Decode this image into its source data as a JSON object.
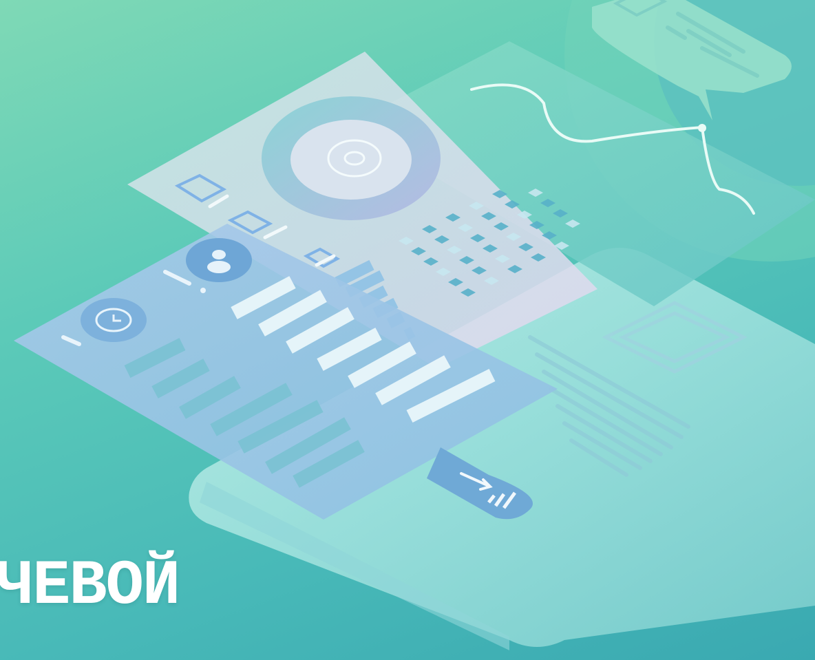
{
  "caption": {
    "text": "ЧЕВОЙ"
  },
  "colors": {
    "bg_top": "#7fd9b6",
    "bg_bottom": "#3aa9b1",
    "phone_body": "#a6e6e3",
    "panel_front": "#9cc8e6",
    "panel_middle": "#d7e0ee",
    "panel_back": "#7fd6c4",
    "accent_bar": "#e8f6f8",
    "dark_accent": "#6aa6d6"
  },
  "icons": [
    "gear-icon",
    "monitor-arrow-icon",
    "clock-icon",
    "user-icon",
    "trend-arrow-icon",
    "bar-chart-icon",
    "line-graph-icon",
    "chat-bubble-icon"
  ]
}
